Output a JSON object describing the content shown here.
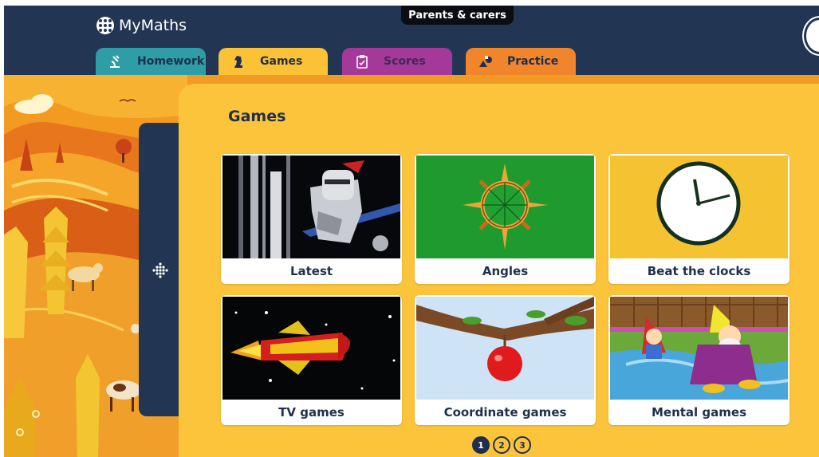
{
  "header": {
    "logo_text": "MyMaths",
    "parents_label": "Parents & carers",
    "exit_icon": "exit-icon"
  },
  "tabs": [
    {
      "label": "Homework",
      "icon": "microscope-icon",
      "color": "#2e9da6"
    },
    {
      "label": "Games",
      "icon": "chess-knight-icon",
      "color": "#fbc137"
    },
    {
      "label": "Scores",
      "icon": "clipboard-check-icon",
      "color": "#a5399a"
    },
    {
      "label": "Practice",
      "icon": "shapes-icon",
      "color": "#f0852c"
    }
  ],
  "main": {
    "title": "Games",
    "cards": [
      {
        "label": "Latest"
      },
      {
        "label": "Angles"
      },
      {
        "label": "Beat the clocks"
      },
      {
        "label": "TV games"
      },
      {
        "label": "Coordinate games"
      },
      {
        "label": "Mental games"
      }
    ]
  },
  "pagination": {
    "pages": [
      "1",
      "2",
      "3"
    ],
    "current": "1"
  },
  "colors": {
    "header_bg": "#223654",
    "panel_bg": "#fbc43b",
    "scene_bg": "#f29b22"
  }
}
